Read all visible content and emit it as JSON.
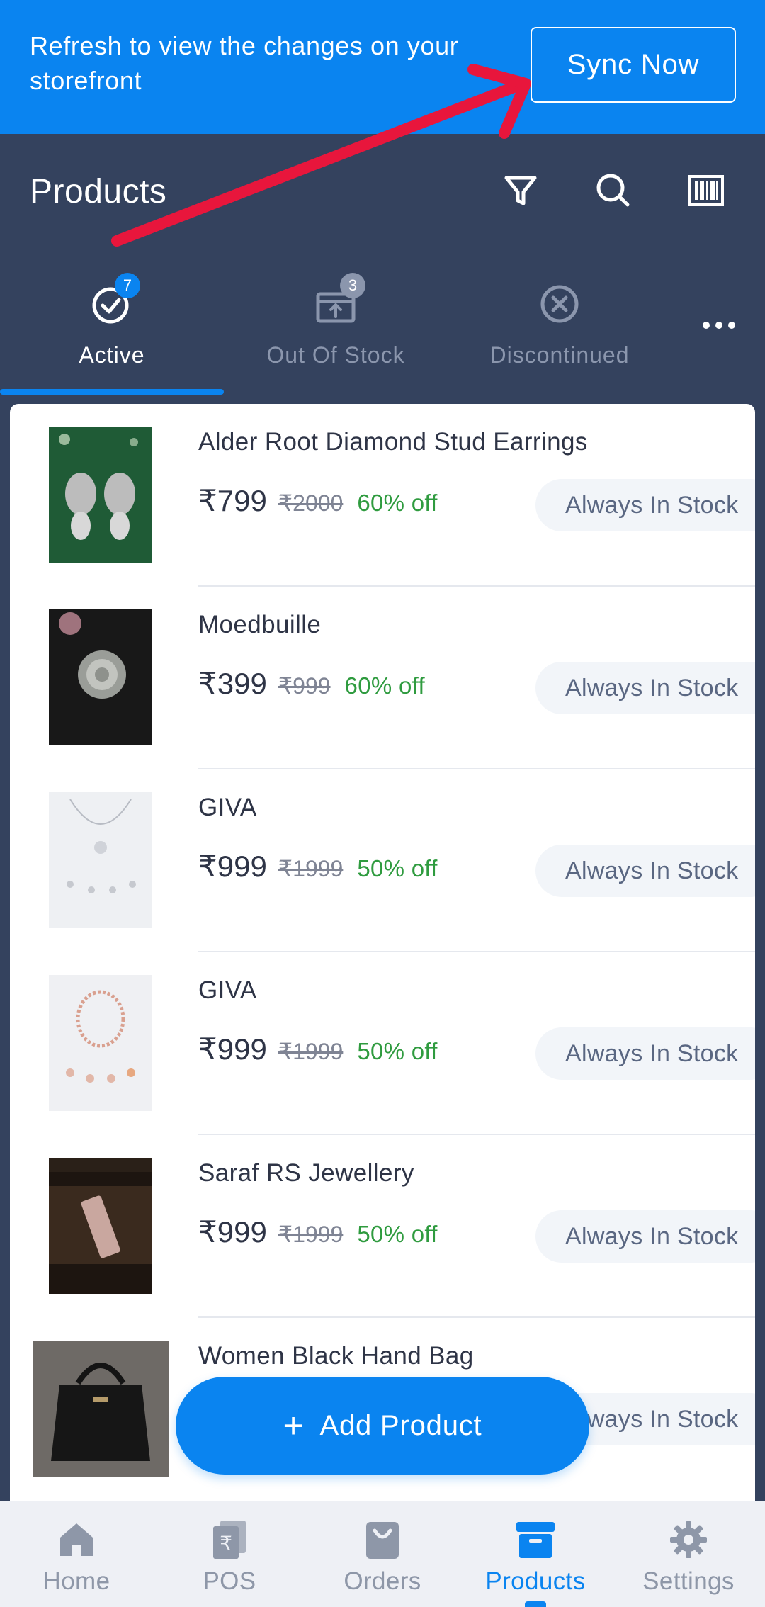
{
  "banner": {
    "message": "Refresh to view the changes on your storefront",
    "sync_label": "Sync Now"
  },
  "header": {
    "title": "Products",
    "icons": [
      "filter-icon",
      "search-icon",
      "barcode-icon"
    ]
  },
  "tabs": [
    {
      "label": "Active",
      "badge": "7",
      "icon": "check-circle-icon",
      "active": true
    },
    {
      "label": "Out Of Stock",
      "badge": "3",
      "icon": "box-icon",
      "active": false
    },
    {
      "label": "Discontinued",
      "icon": "x-circle-icon",
      "active": false
    }
  ],
  "products": [
    {
      "name": "Alder Root Diamond Stud Earrings",
      "price": "₹799",
      "mrp": "₹2000",
      "discount": "60% off",
      "stock": "Always In Stock"
    },
    {
      "name": "Moedbuille",
      "price": "₹399",
      "mrp": "₹999",
      "discount": "60% off",
      "stock": "Always In Stock"
    },
    {
      "name": "GIVA",
      "price": "₹999",
      "mrp": "₹1999",
      "discount": "50% off",
      "stock": "Always In Stock"
    },
    {
      "name": "GIVA",
      "price": "₹999",
      "mrp": "₹1999",
      "discount": "50% off",
      "stock": "Always In Stock"
    },
    {
      "name": "Saraf RS Jewellery",
      "price": "₹999",
      "mrp": "₹1999",
      "discount": "50% off",
      "stock": "Always In Stock"
    },
    {
      "name": "Women Black Hand Bag",
      "stock": "Always In Stock"
    }
  ],
  "fab": {
    "plus": "+",
    "label": "Add Product"
  },
  "nav": [
    {
      "label": "Home",
      "icon": "home-icon",
      "active": false
    },
    {
      "label": "POS",
      "icon": "rupee-receipt-icon",
      "active": false
    },
    {
      "label": "Orders",
      "icon": "bag-icon",
      "active": false
    },
    {
      "label": "Products",
      "icon": "archive-icon",
      "active": true
    },
    {
      "label": "Settings",
      "icon": "gear-icon",
      "active": false
    }
  ],
  "colors": {
    "brand_blue": "#0a84f0",
    "header_bg": "#34425e",
    "discount_green": "#2f9b3f",
    "annotation_red": "#e8163c"
  }
}
